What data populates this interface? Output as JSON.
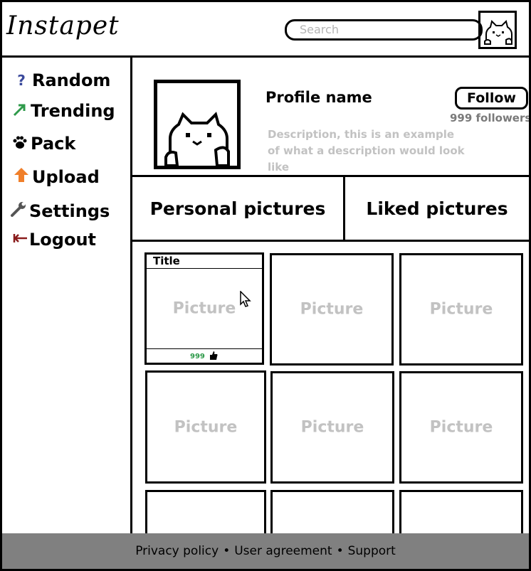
{
  "app": {
    "logo": "Instapet"
  },
  "search": {
    "placeholder": "Search"
  },
  "sidebar": {
    "items": [
      {
        "label": "Random",
        "icon": "question-icon",
        "color": "#3b4a9c"
      },
      {
        "label": "Trending",
        "icon": "trend-arrow-icon",
        "color": "#2e9a4a"
      },
      {
        "label": "Pack",
        "icon": "paw-icon",
        "color": "#000000"
      },
      {
        "label": "Upload",
        "icon": "upload-arrow-icon",
        "color": "#f07f2a"
      },
      {
        "label": "Settings",
        "icon": "wrench-icon",
        "color": "#555555"
      },
      {
        "label": "Logout",
        "icon": "logout-arrow-icon",
        "color": "#8a1c1c"
      }
    ]
  },
  "profile": {
    "name": "Profile name",
    "follow_label": "Follow",
    "followers": "999 followers",
    "description": "Description, this is an example of what a description would look like"
  },
  "tabs": [
    {
      "label": "Personal pictures"
    },
    {
      "label": "Liked pictures"
    }
  ],
  "grid": {
    "featured": {
      "title": "Title",
      "label": "Picture",
      "likes": "999"
    },
    "cards": [
      {
        "label": "Picture"
      },
      {
        "label": "Picture"
      },
      {
        "label": "Picture"
      },
      {
        "label": "Picture"
      },
      {
        "label": "Picture"
      }
    ]
  },
  "footer": {
    "links": [
      "Privacy policy",
      "User agreement",
      "Support"
    ],
    "separator": "•"
  }
}
